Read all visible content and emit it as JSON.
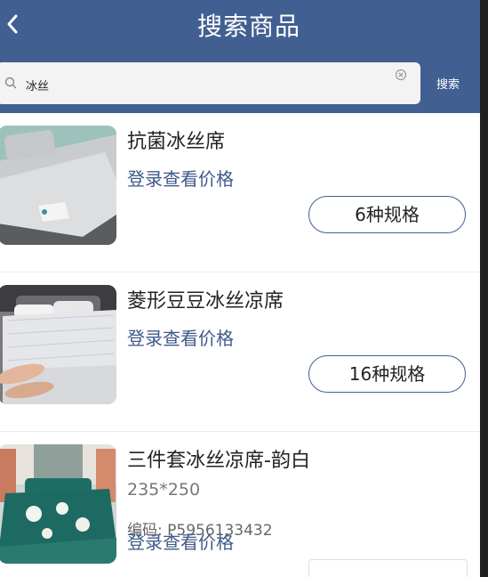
{
  "header": {
    "title": "搜索商品"
  },
  "search": {
    "value": "冰丝",
    "button_label": "搜索"
  },
  "products": [
    {
      "name": "抗菌冰丝席",
      "price_link": "登录查看价格",
      "spec_label": "6种规格"
    },
    {
      "name": "菱形豆豆冰丝凉席",
      "price_link": "登录查看价格",
      "spec_label": "16种规格"
    },
    {
      "name": "三件套冰丝凉席-韵白",
      "size": "235*250",
      "code": "编码: P5956133432",
      "price_link": "登录查看价格"
    }
  ],
  "colors": {
    "header_bg": "#425f92",
    "link": "#3d5a8a"
  }
}
